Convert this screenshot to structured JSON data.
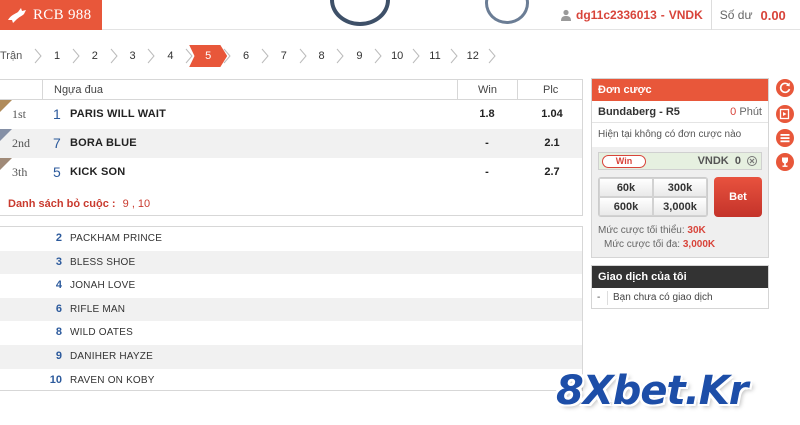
{
  "header": {
    "logo_text": "RCB 988",
    "username": "dg11c2336013",
    "separator": "-",
    "currency": "VNDK",
    "balance_label": "Số dư",
    "balance_value": "0.00"
  },
  "race_tabs": {
    "label": "Trận",
    "tabs": [
      "1",
      "2",
      "3",
      "4",
      "5",
      "6",
      "7",
      "8",
      "9",
      "10",
      "11",
      "12"
    ],
    "active": "5"
  },
  "results": {
    "columns": {
      "horse": "Ngựa đua",
      "win": "Win",
      "plc": "Plc"
    },
    "rows": [
      {
        "place": "1st",
        "number": "1",
        "name": "PARIS WILL WAIT",
        "win": "1.8",
        "plc": "1.04"
      },
      {
        "place": "2nd",
        "number": "7",
        "name": "BORA BLUE",
        "win": "-",
        "plc": "2.1"
      },
      {
        "place": "3th",
        "number": "5",
        "name": "KICK SON",
        "win": "-",
        "plc": "2.7"
      }
    ],
    "scratch_label": "Danh sách bỏ cuộc :",
    "scratch_value": "9 , 10"
  },
  "runners": [
    {
      "number": "2",
      "name": "PACKHAM PRINCE"
    },
    {
      "number": "3",
      "name": "BLESS SHOE"
    },
    {
      "number": "4",
      "name": "JONAH LOVE"
    },
    {
      "number": "6",
      "name": "RIFLE MAN"
    },
    {
      "number": "8",
      "name": "WILD OATES"
    },
    {
      "number": "9",
      "name": "DANIHER HAYZE"
    },
    {
      "number": "10",
      "name": "RAVEN ON KOBY"
    }
  ],
  "betslip": {
    "title": "Đơn cược",
    "race_name": "Bundaberg - R5",
    "minutes_value": "0",
    "minutes_label": "Phút",
    "empty_text": "Hiện tại không có đơn cược nào",
    "stake_type": "Win",
    "stake_currency": "VNDK",
    "stake_amount": "0",
    "chips": [
      "60k",
      "300k",
      "600k",
      "3,000k"
    ],
    "bet_button": "Bet",
    "min_label": "Mức cược tối thiểu:",
    "min_value": "30K",
    "max_label": "Mức cược tối đa:",
    "max_value": "3,000K"
  },
  "my_transactions": {
    "title": "Giao dịch của tôi",
    "dash": "-",
    "empty_text": "Bạn chưa có giao dịch"
  },
  "watermark": {
    "prefix": "8",
    "x": "X",
    "suffix": "bet.Kr"
  },
  "colors": {
    "accent": "#e8573a",
    "link_blue": "#2c5a9c",
    "dark_header": "#333333"
  }
}
